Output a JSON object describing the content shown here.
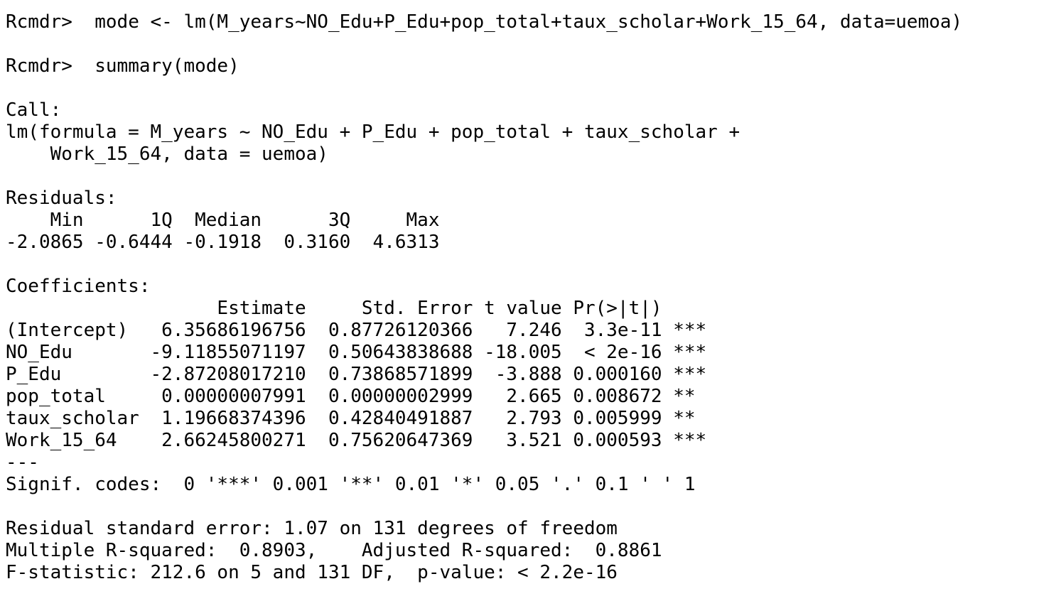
{
  "console": {
    "command1": {
      "prompt": "Rcmdr>",
      "text": "mode <- lm(M_years~NO_Edu+P_Edu+pop_total+taux_scholar+Work_15_64, data=uemoa)"
    },
    "command2": {
      "prompt": "Rcmdr>",
      "text": "summary(mode)"
    },
    "call": {
      "header": "Call:",
      "line1": "lm(formula = M_years ~ NO_Edu + P_Edu + pop_total + taux_scholar +",
      "line2": "    Work_15_64, data = uemoa)"
    },
    "residuals": {
      "header": "Residuals:",
      "labels": "    Min      1Q  Median      3Q     Max ",
      "values": "-2.0865 -0.6444 -0.1918  0.3160  4.6313 "
    },
    "coefficients": {
      "header": "Coefficients:",
      "columns": "                   Estimate     Std. Error t value Pr(>|t|)    ",
      "rows": [
        "(Intercept)   6.35686196756  0.87726120366   7.246  3.3e-11 ***",
        "NO_Edu       -9.11855071197  0.50643838688 -18.005  < 2e-16 ***",
        "P_Edu        -2.87208017210  0.73868571899  -3.888 0.000160 ***",
        "pop_total     0.00000007991  0.00000002999   2.665 0.008672 ** ",
        "taux_scholar  1.19668374396  0.42840491887   2.793 0.005999 ** ",
        "Work_15_64    2.66245800271  0.75620647369   3.521 0.000593 ***"
      ],
      "separator": "---",
      "signif": "Signif. codes:  0 '***' 0.001 '**' 0.01 '*' 0.05 '.' 0.1 ' ' 1"
    },
    "fit": {
      "rse": "Residual standard error: 1.07 on 131 degrees of freedom",
      "r2": "Multiple R-squared:  0.8903,\tAdjusted R-squared:  0.8861 ",
      "f": "F-statistic: 212.6 on 5 and 131 DF,  p-value: < 2.2e-16"
    }
  }
}
